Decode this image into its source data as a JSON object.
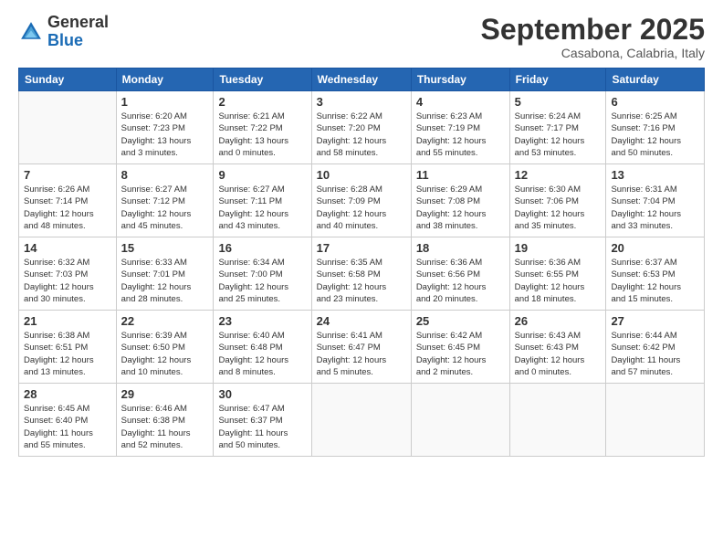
{
  "logo": {
    "general": "General",
    "blue": "Blue"
  },
  "header": {
    "month": "September 2025",
    "location": "Casabona, Calabria, Italy"
  },
  "weekdays": [
    "Sunday",
    "Monday",
    "Tuesday",
    "Wednesday",
    "Thursday",
    "Friday",
    "Saturday"
  ],
  "weeks": [
    [
      {
        "day": "",
        "info": ""
      },
      {
        "day": "1",
        "info": "Sunrise: 6:20 AM\nSunset: 7:23 PM\nDaylight: 13 hours\nand 3 minutes."
      },
      {
        "day": "2",
        "info": "Sunrise: 6:21 AM\nSunset: 7:22 PM\nDaylight: 13 hours\nand 0 minutes."
      },
      {
        "day": "3",
        "info": "Sunrise: 6:22 AM\nSunset: 7:20 PM\nDaylight: 12 hours\nand 58 minutes."
      },
      {
        "day": "4",
        "info": "Sunrise: 6:23 AM\nSunset: 7:19 PM\nDaylight: 12 hours\nand 55 minutes."
      },
      {
        "day": "5",
        "info": "Sunrise: 6:24 AM\nSunset: 7:17 PM\nDaylight: 12 hours\nand 53 minutes."
      },
      {
        "day": "6",
        "info": "Sunrise: 6:25 AM\nSunset: 7:16 PM\nDaylight: 12 hours\nand 50 minutes."
      }
    ],
    [
      {
        "day": "7",
        "info": "Sunrise: 6:26 AM\nSunset: 7:14 PM\nDaylight: 12 hours\nand 48 minutes."
      },
      {
        "day": "8",
        "info": "Sunrise: 6:27 AM\nSunset: 7:12 PM\nDaylight: 12 hours\nand 45 minutes."
      },
      {
        "day": "9",
        "info": "Sunrise: 6:27 AM\nSunset: 7:11 PM\nDaylight: 12 hours\nand 43 minutes."
      },
      {
        "day": "10",
        "info": "Sunrise: 6:28 AM\nSunset: 7:09 PM\nDaylight: 12 hours\nand 40 minutes."
      },
      {
        "day": "11",
        "info": "Sunrise: 6:29 AM\nSunset: 7:08 PM\nDaylight: 12 hours\nand 38 minutes."
      },
      {
        "day": "12",
        "info": "Sunrise: 6:30 AM\nSunset: 7:06 PM\nDaylight: 12 hours\nand 35 minutes."
      },
      {
        "day": "13",
        "info": "Sunrise: 6:31 AM\nSunset: 7:04 PM\nDaylight: 12 hours\nand 33 minutes."
      }
    ],
    [
      {
        "day": "14",
        "info": "Sunrise: 6:32 AM\nSunset: 7:03 PM\nDaylight: 12 hours\nand 30 minutes."
      },
      {
        "day": "15",
        "info": "Sunrise: 6:33 AM\nSunset: 7:01 PM\nDaylight: 12 hours\nand 28 minutes."
      },
      {
        "day": "16",
        "info": "Sunrise: 6:34 AM\nSunset: 7:00 PM\nDaylight: 12 hours\nand 25 minutes."
      },
      {
        "day": "17",
        "info": "Sunrise: 6:35 AM\nSunset: 6:58 PM\nDaylight: 12 hours\nand 23 minutes."
      },
      {
        "day": "18",
        "info": "Sunrise: 6:36 AM\nSunset: 6:56 PM\nDaylight: 12 hours\nand 20 minutes."
      },
      {
        "day": "19",
        "info": "Sunrise: 6:36 AM\nSunset: 6:55 PM\nDaylight: 12 hours\nand 18 minutes."
      },
      {
        "day": "20",
        "info": "Sunrise: 6:37 AM\nSunset: 6:53 PM\nDaylight: 12 hours\nand 15 minutes."
      }
    ],
    [
      {
        "day": "21",
        "info": "Sunrise: 6:38 AM\nSunset: 6:51 PM\nDaylight: 12 hours\nand 13 minutes."
      },
      {
        "day": "22",
        "info": "Sunrise: 6:39 AM\nSunset: 6:50 PM\nDaylight: 12 hours\nand 10 minutes."
      },
      {
        "day": "23",
        "info": "Sunrise: 6:40 AM\nSunset: 6:48 PM\nDaylight: 12 hours\nand 8 minutes."
      },
      {
        "day": "24",
        "info": "Sunrise: 6:41 AM\nSunset: 6:47 PM\nDaylight: 12 hours\nand 5 minutes."
      },
      {
        "day": "25",
        "info": "Sunrise: 6:42 AM\nSunset: 6:45 PM\nDaylight: 12 hours\nand 2 minutes."
      },
      {
        "day": "26",
        "info": "Sunrise: 6:43 AM\nSunset: 6:43 PM\nDaylight: 12 hours\nand 0 minutes."
      },
      {
        "day": "27",
        "info": "Sunrise: 6:44 AM\nSunset: 6:42 PM\nDaylight: 11 hours\nand 57 minutes."
      }
    ],
    [
      {
        "day": "28",
        "info": "Sunrise: 6:45 AM\nSunset: 6:40 PM\nDaylight: 11 hours\nand 55 minutes."
      },
      {
        "day": "29",
        "info": "Sunrise: 6:46 AM\nSunset: 6:38 PM\nDaylight: 11 hours\nand 52 minutes."
      },
      {
        "day": "30",
        "info": "Sunrise: 6:47 AM\nSunset: 6:37 PM\nDaylight: 11 hours\nand 50 minutes."
      },
      {
        "day": "",
        "info": ""
      },
      {
        "day": "",
        "info": ""
      },
      {
        "day": "",
        "info": ""
      },
      {
        "day": "",
        "info": ""
      }
    ]
  ]
}
